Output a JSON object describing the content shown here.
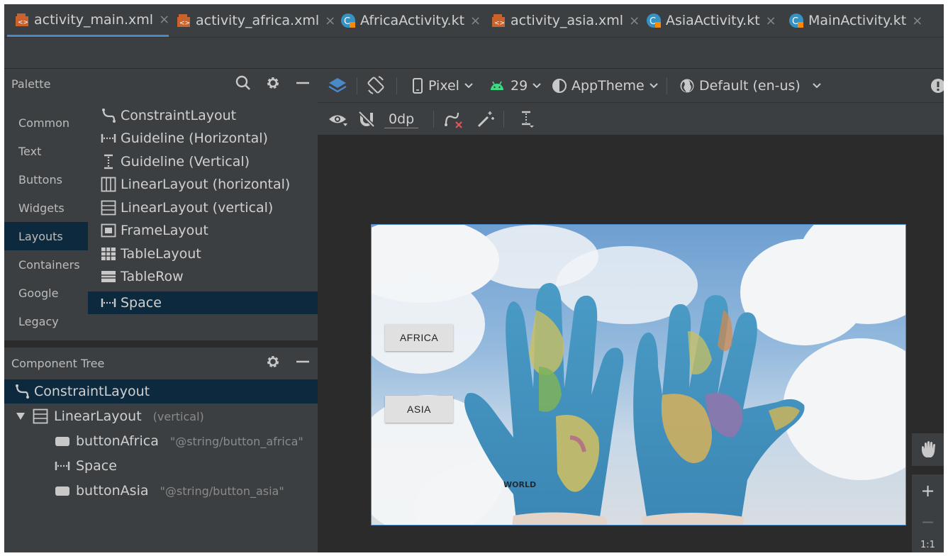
{
  "tabs": [
    {
      "label": "activity_main.xml",
      "type": "xml",
      "active": true
    },
    {
      "label": "activity_africa.xml",
      "type": "xml",
      "active": false
    },
    {
      "label": "AfricaActivity.kt",
      "type": "kotlin",
      "active": false
    },
    {
      "label": "activity_asia.xml",
      "type": "xml",
      "active": false
    },
    {
      "label": "AsiaActivity.kt",
      "type": "kotlin",
      "active": false
    },
    {
      "label": "MainActivity.kt",
      "type": "kotlin",
      "active": false
    }
  ],
  "tab_close_glyph": "×",
  "palette": {
    "title": "Palette",
    "categories": [
      "Common",
      "Text",
      "Buttons",
      "Widgets",
      "Layouts",
      "Containers",
      "Google",
      "Legacy"
    ],
    "selected_category": "Layouts",
    "items": [
      {
        "label": "ConstraintLayout",
        "icon": "constraint-layout-icon"
      },
      {
        "label": "Guideline (Horizontal)",
        "icon": "guideline-horizontal-icon"
      },
      {
        "label": "Guideline (Vertical)",
        "icon": "guideline-vertical-icon"
      },
      {
        "label": "LinearLayout (horizontal)",
        "icon": "linear-horizontal-icon"
      },
      {
        "label": "LinearLayout (vertical)",
        "icon": "linear-vertical-icon"
      },
      {
        "label": "FrameLayout",
        "icon": "frame-layout-icon"
      },
      {
        "label": "TableLayout",
        "icon": "table-layout-icon"
      },
      {
        "label": "TableRow",
        "icon": "table-row-icon"
      },
      {
        "label": "Space",
        "icon": "space-icon"
      }
    ],
    "selected_item": "Space"
  },
  "component_tree": {
    "title": "Component Tree",
    "nodes": [
      {
        "label": "ConstraintLayout",
        "sub": ""
      },
      {
        "label": "LinearLayout",
        "sub": "(vertical)"
      },
      {
        "label": "buttonAfrica",
        "sub": "\"@string/button_africa\""
      },
      {
        "label": "Space",
        "sub": ""
      },
      {
        "label": "buttonAsia",
        "sub": "\"@string/button_asia\""
      }
    ]
  },
  "toolbar": {
    "device": "Pixel",
    "api": "29",
    "theme": "AppTheme",
    "locale": "Default (en-us)",
    "margin": "0dp"
  },
  "preview": {
    "button_africa": "AFRICA",
    "button_asia": "ASIA",
    "map_label_world": "WORLD"
  },
  "side_tools": {
    "zoom_in": "+",
    "zoom_out": "−",
    "fit": "1:1"
  },
  "colors": {
    "accent": "#4a88c7",
    "selection": "#0d293e",
    "panel": "#3c3f41",
    "editor_bg": "#2b2b2b",
    "android_green": "#3ddc84"
  }
}
